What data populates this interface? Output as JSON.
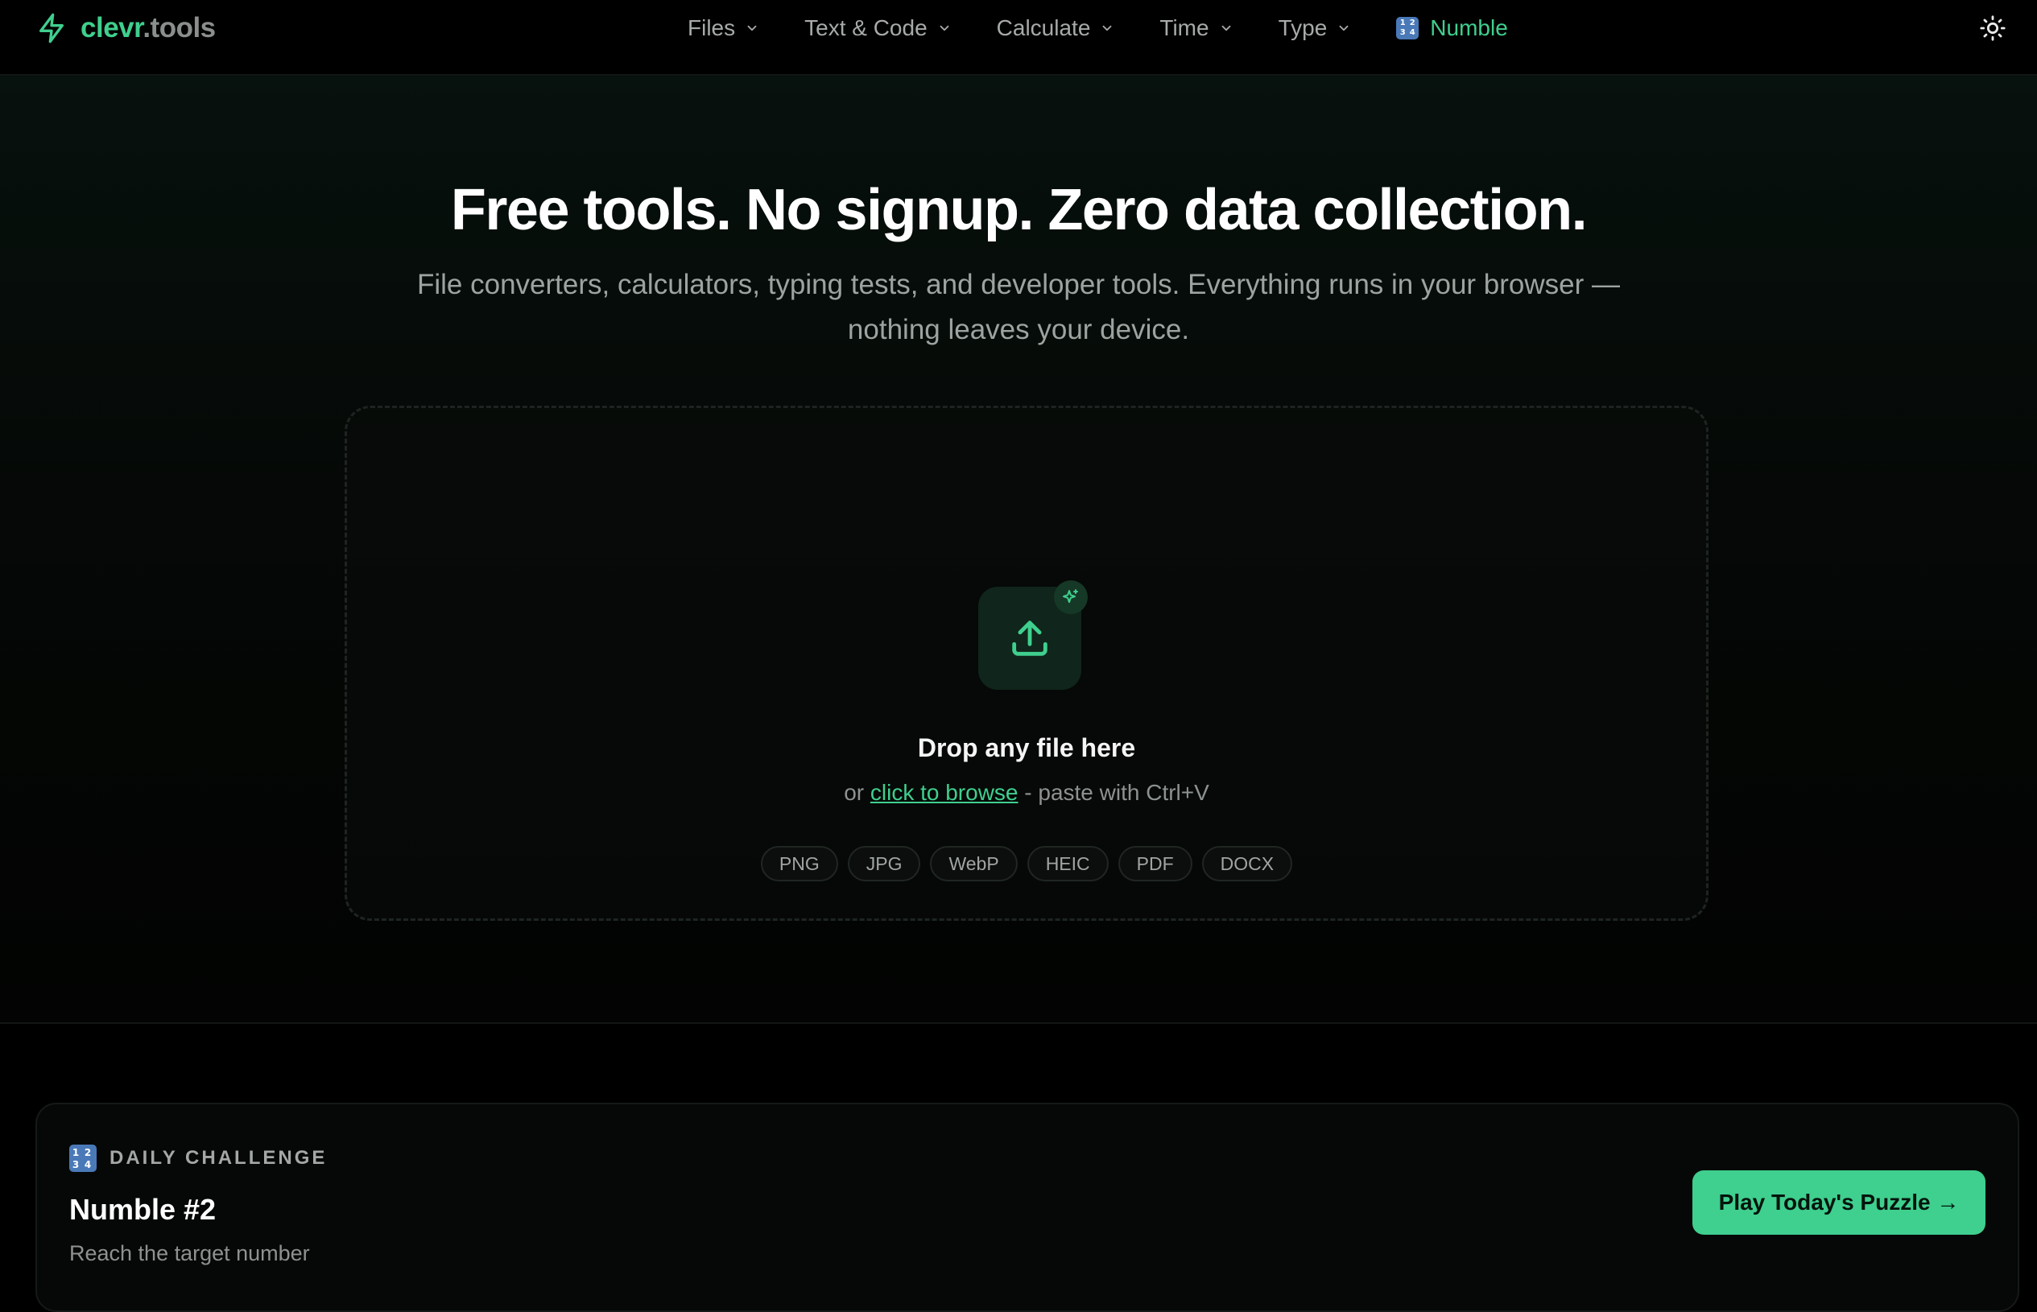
{
  "brand": {
    "name_primary": "clevr",
    "name_secondary": ".tools",
    "icon": "lightning-bolt-icon"
  },
  "nav": {
    "items": [
      {
        "label": "Files",
        "icon": "chevron-down-icon"
      },
      {
        "label": "Text & Code",
        "icon": "chevron-down-icon"
      },
      {
        "label": "Calculate",
        "icon": "chevron-down-icon"
      },
      {
        "label": "Time",
        "icon": "chevron-down-icon"
      },
      {
        "label": "Type",
        "icon": "chevron-down-icon"
      }
    ],
    "featured": {
      "label": "Numble",
      "icon": "numbers-emoji-icon",
      "digits": [
        "1",
        "2",
        "3",
        "4"
      ]
    },
    "theme_toggle_icon": "sun-icon"
  },
  "hero": {
    "title": "Free tools. No signup. Zero data collection.",
    "subtitle": "File converters, calculators, typing tests, and developer tools. Everything runs in your browser — nothing leaves your device."
  },
  "dropzone": {
    "icon": "upload-icon",
    "badge_icon": "sparkle-icon",
    "title": "Drop any file here",
    "hint_prefix": "or ",
    "browse_link": "click to browse",
    "hint_suffix": " - paste with Ctrl+V",
    "formats": [
      "PNG",
      "JPG",
      "WebP",
      "HEIC",
      "PDF",
      "DOCX"
    ]
  },
  "challenge": {
    "kicker": "DAILY CHALLENGE",
    "title": "Numble #2",
    "description": "Reach the target number",
    "cta": "Play Today's Puzzle →"
  },
  "colors": {
    "accent": "#3fcf8e",
    "background": "#000000",
    "muted_text": "#9ea3a0"
  }
}
